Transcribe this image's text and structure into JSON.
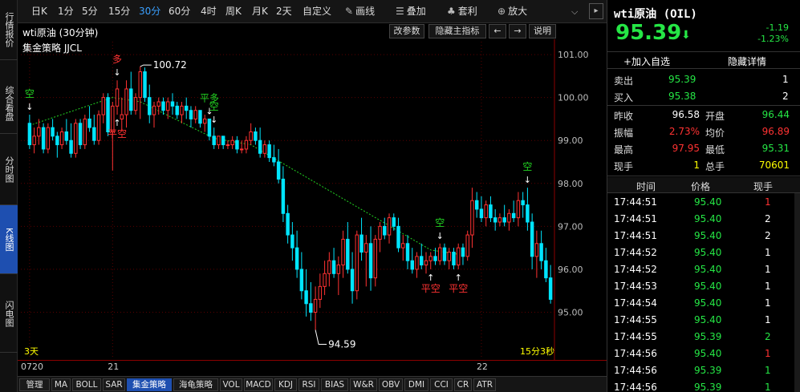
{
  "left_nav": [
    {
      "label": "行情报价",
      "active": false
    },
    {
      "label": "综合看盘",
      "active": false
    },
    {
      "label": "分时图",
      "active": false
    },
    {
      "label": "K线图",
      "active": true
    },
    {
      "label": "闪电图",
      "active": false
    }
  ],
  "toolbar": {
    "periods": [
      "日K",
      "1分",
      "5分",
      "15分",
      "30分",
      "60分",
      "4时",
      "周K",
      "月K",
      "2天",
      "自定义"
    ],
    "active_period": "30分",
    "tools": [
      {
        "label": "画线",
        "icon": "pen-icon"
      },
      {
        "label": "叠加",
        "icon": "layers-icon"
      },
      {
        "label": "套利",
        "icon": "moneybag-icon"
      },
      {
        "label": "放大",
        "icon": "zoom-in-icon"
      }
    ]
  },
  "chart_header": {
    "title": "wti原油 (30分钟)",
    "buttons": [
      "改参数",
      "隐藏主指标",
      "←",
      "→",
      "说明"
    ],
    "strategy": "集金策略 JJCL",
    "bottom_left_label": "3天",
    "bottom_right_label": "15分3秒"
  },
  "chart_data": {
    "type": "candlestick",
    "title": "wti原油 (30分钟)",
    "ylim": [
      94.3,
      101.3
    ],
    "y_ticks": [
      "101.00",
      "100.00",
      "99.00",
      "98.00",
      "97.00",
      "96.00",
      "95.00"
    ],
    "x_labels": [
      "0720",
      "21",
      "22"
    ],
    "candles": [
      [
        99.4,
        99.6,
        98.8,
        98.9
      ],
      [
        98.9,
        99.3,
        98.7,
        99.1
      ],
      [
        99.1,
        99.5,
        98.9,
        99.3
      ],
      [
        99.3,
        99.4,
        98.7,
        98.8
      ],
      [
        98.8,
        99.4,
        98.7,
        99.3
      ],
      [
        99.3,
        99.5,
        99.0,
        99.1
      ],
      [
        99.1,
        99.2,
        98.6,
        98.9
      ],
      [
        98.9,
        99.3,
        98.8,
        99.2
      ],
      [
        99.2,
        99.5,
        98.9,
        99.0
      ],
      [
        99.0,
        99.4,
        98.6,
        98.7
      ],
      [
        98.7,
        99.5,
        98.6,
        99.4
      ],
      [
        99.4,
        99.5,
        98.8,
        98.9
      ],
      [
        98.9,
        99.6,
        98.8,
        99.5
      ],
      [
        99.5,
        99.8,
        99.2,
        99.3
      ],
      [
        99.3,
        99.6,
        98.9,
        99.0
      ],
      [
        99.0,
        99.7,
        98.9,
        99.6
      ],
      [
        99.6,
        100.1,
        99.4,
        100.0
      ],
      [
        100.0,
        100.1,
        99.1,
        99.2
      ],
      [
        99.2,
        99.9,
        98.3,
        99.8
      ],
      [
        99.8,
        100.4,
        99.6,
        100.2
      ],
      [
        99.5,
        100.0,
        99.2,
        99.6
      ],
      [
        99.6,
        100.4,
        99.3,
        100.2
      ],
      [
        100.2,
        100.6,
        99.6,
        99.7
      ],
      [
        99.7,
        100.1,
        99.6,
        100.0
      ],
      [
        100.0,
        100.72,
        99.5,
        100.6
      ],
      [
        100.6,
        100.7,
        99.9,
        100.0
      ],
      [
        100.0,
        100.3,
        99.4,
        99.6
      ],
      [
        99.6,
        99.9,
        99.3,
        99.8
      ],
      [
        99.8,
        100.0,
        99.6,
        99.9
      ],
      [
        99.9,
        100.0,
        99.6,
        99.7
      ],
      [
        99.7,
        100.0,
        99.5,
        99.9
      ],
      [
        99.9,
        100.1,
        99.6,
        99.8
      ],
      [
        99.8,
        99.9,
        99.5,
        99.6
      ],
      [
        99.6,
        99.9,
        99.4,
        99.8
      ],
      [
        99.8,
        100.0,
        99.5,
        99.7
      ],
      [
        99.7,
        99.8,
        99.3,
        99.5
      ],
      [
        99.5,
        99.8,
        99.4,
        99.7
      ],
      [
        99.7,
        99.7,
        99.3,
        99.4
      ],
      [
        99.4,
        99.6,
        99.2,
        99.5
      ],
      [
        99.5,
        99.5,
        99.0,
        99.1
      ],
      [
        99.1,
        99.3,
        98.8,
        98.9
      ],
      [
        98.9,
        99.1,
        98.8,
        99.1
      ],
      [
        99.1,
        99.1,
        98.8,
        98.9
      ],
      [
        98.9,
        99.0,
        98.8,
        98.9
      ],
      [
        98.9,
        99.1,
        98.8,
        99.0
      ],
      [
        99.0,
        99.1,
        98.7,
        98.8
      ],
      [
        98.8,
        99.0,
        98.7,
        98.8
      ],
      [
        98.8,
        99.1,
        98.7,
        99.0
      ],
      [
        99.0,
        99.4,
        98.9,
        99.2
      ],
      [
        99.2,
        99.3,
        98.9,
        99.0
      ],
      [
        99.0,
        99.3,
        98.6,
        98.7
      ],
      [
        98.7,
        99.0,
        98.6,
        98.9
      ],
      [
        98.9,
        99.0,
        98.5,
        98.6
      ],
      [
        98.6,
        98.9,
        98.4,
        98.5
      ],
      [
        98.5,
        98.8,
        98.0,
        98.1
      ],
      [
        98.1,
        98.4,
        97.1,
        97.3
      ],
      [
        97.3,
        97.5,
        96.6,
        96.8
      ],
      [
        96.8,
        97.1,
        96.2,
        96.5
      ],
      [
        96.5,
        96.9,
        95.8,
        96.0
      ],
      [
        96.0,
        96.4,
        95.3,
        95.5
      ],
      [
        95.5,
        96.0,
        94.9,
        95.2
      ],
      [
        95.2,
        95.7,
        94.8,
        95.0
      ],
      [
        95.0,
        95.6,
        94.59,
        95.3
      ],
      [
        95.3,
        95.9,
        95.1,
        95.6
      ],
      [
        95.6,
        96.2,
        95.4,
        95.9
      ],
      [
        95.9,
        96.4,
        95.6,
        96.2
      ],
      [
        96.2,
        96.5,
        95.8,
        95.9
      ],
      [
        95.9,
        96.3,
        95.4,
        96.1
      ],
      [
        96.1,
        96.9,
        95.8,
        96.7
      ],
      [
        96.7,
        97.1,
        95.9,
        96.0
      ],
      [
        96.0,
        96.4,
        95.2,
        95.5
      ],
      [
        95.5,
        96.9,
        95.3,
        96.8
      ],
      [
        96.8,
        97.2,
        96.2,
        96.4
      ],
      [
        96.4,
        96.8,
        95.6,
        96.6
      ],
      [
        96.6,
        97.0,
        95.5,
        95.8
      ],
      [
        95.8,
        96.8,
        95.6,
        96.7
      ],
      [
        96.7,
        97.1,
        96.4,
        97.0
      ],
      [
        97.0,
        97.2,
        96.7,
        96.8
      ],
      [
        96.8,
        97.3,
        96.6,
        97.2
      ],
      [
        97.2,
        97.3,
        96.9,
        97.0
      ],
      [
        97.0,
        97.2,
        96.4,
        96.5
      ],
      [
        96.5,
        96.8,
        96.2,
        96.6
      ],
      [
        96.6,
        96.8,
        96.0,
        96.2
      ],
      [
        96.2,
        96.5,
        95.9,
        96.0
      ],
      [
        96.0,
        96.4,
        95.8,
        96.3
      ],
      [
        96.3,
        96.6,
        96.0,
        96.1
      ],
      [
        96.1,
        96.4,
        95.9,
        96.2
      ],
      [
        96.2,
        96.4,
        96.0,
        96.3
      ],
      [
        96.3,
        96.5,
        96.1,
        96.2
      ],
      [
        96.2,
        96.6,
        96.1,
        96.5
      ],
      [
        96.5,
        96.6,
        96.1,
        96.2
      ],
      [
        96.2,
        96.5,
        96.0,
        96.4
      ],
      [
        96.4,
        96.5,
        96.0,
        96.1
      ],
      [
        96.1,
        96.6,
        96.0,
        96.5
      ],
      [
        96.5,
        96.6,
        96.1,
        96.3
      ],
      [
        96.3,
        96.9,
        96.2,
        96.8
      ],
      [
        96.8,
        97.9,
        96.5,
        97.6
      ],
      [
        97.6,
        97.8,
        97.2,
        97.4
      ],
      [
        97.4,
        97.7,
        97.1,
        97.2
      ],
      [
        97.2,
        97.6,
        97.0,
        97.5
      ],
      [
        97.5,
        97.7,
        97.1,
        97.2
      ],
      [
        97.2,
        97.4,
        96.9,
        97.1
      ],
      [
        97.1,
        97.3,
        97.0,
        97.2
      ],
      [
        97.2,
        97.5,
        97.0,
        97.1
      ],
      [
        97.1,
        97.4,
        96.9,
        97.3
      ],
      [
        97.3,
        97.6,
        97.1,
        97.2
      ],
      [
        97.2,
        97.8,
        97.0,
        97.6
      ],
      [
        97.6,
        97.8,
        97.2,
        97.5
      ],
      [
        97.5,
        97.9,
        96.9,
        97.1
      ],
      [
        97.1,
        97.3,
        96.0,
        96.3
      ],
      [
        96.3,
        96.9,
        95.8,
        96.6
      ],
      [
        96.6,
        96.9,
        96.0,
        96.2
      ],
      [
        96.2,
        96.5,
        95.7,
        95.8
      ],
      [
        95.8,
        96.1,
        95.2,
        95.3
      ]
    ],
    "signals": [
      {
        "label": "空",
        "index": 0,
        "type": "open-short"
      },
      {
        "label": "多",
        "index": 19,
        "type": "open-long"
      },
      {
        "label": "平空",
        "index": 19,
        "type": "close-short"
      },
      {
        "label": "平多",
        "index": 39,
        "type": "close-long"
      },
      {
        "label": "空",
        "index": 40,
        "type": "open-short"
      },
      {
        "label": "平空",
        "index": 87,
        "type": "close-short"
      },
      {
        "label": "空",
        "index": 89,
        "type": "open-short"
      },
      {
        "label": "平空",
        "index": 93,
        "type": "close-short"
      },
      {
        "label": "空",
        "index": 108,
        "type": "open-short"
      }
    ],
    "annotations": [
      {
        "label": "100.72",
        "index": 24,
        "price": 100.72
      },
      {
        "label": "94.59",
        "index": 62,
        "price": 94.59
      }
    ],
    "trend_path": [
      [
        0,
        99.35
      ],
      [
        18,
        100.0
      ],
      [
        24,
        99.9
      ],
      [
        40,
        99.05
      ],
      [
        48,
        98.9
      ],
      [
        87,
        96.45
      ],
      [
        93,
        96.35
      ]
    ],
    "up_color": "#ff3232",
    "down_color": "#00e5ff",
    "trend_color": "#22d322"
  },
  "quote": {
    "name": "wti原油 (OIL)",
    "price": "95.39",
    "change": "-1.19",
    "change_pct": "-1.23%",
    "add_watch": "+加入自选",
    "hide_detail": "隐藏详情",
    "ask_label": "卖出",
    "ask_price": "95.39",
    "ask_vol": "1",
    "bid_label": "买入",
    "bid_price": "95.38",
    "bid_vol": "2",
    "stats": [
      {
        "l1": "昨收",
        "v1": "96.58",
        "c1": "#ffffff",
        "l2": "开盘",
        "v2": "96.44",
        "c2": "#25e645"
      },
      {
        "l1": "振幅",
        "v1": "2.73%",
        "c1": "#ff3232",
        "l2": "均价",
        "v2": "96.89",
        "c2": "#ff3232"
      },
      {
        "l1": "最高",
        "v1": "97.95",
        "c1": "#ff3232",
        "l2": "最低",
        "v2": "95.31",
        "c2": "#25e645"
      },
      {
        "l1": "现手",
        "v1": "1",
        "c1": "#ffff00",
        "l2": "总手",
        "v2": "70601",
        "c2": "#ffff00"
      }
    ],
    "tick_header": [
      "时间",
      "价格",
      "现手"
    ],
    "ticks": [
      {
        "time": "17:44:51",
        "price": "95.40",
        "vol": "1",
        "vc": "#ff3232"
      },
      {
        "time": "17:44:51",
        "price": "95.40",
        "vol": "2",
        "vc": "#ffffff"
      },
      {
        "time": "17:44:51",
        "price": "95.40",
        "vol": "2",
        "vc": "#ffffff"
      },
      {
        "time": "17:44:52",
        "price": "95.40",
        "vol": "1",
        "vc": "#ffffff"
      },
      {
        "time": "17:44:52",
        "price": "95.40",
        "vol": "1",
        "vc": "#ffffff"
      },
      {
        "time": "17:44:53",
        "price": "95.40",
        "vol": "1",
        "vc": "#ffffff"
      },
      {
        "time": "17:44:54",
        "price": "95.40",
        "vol": "1",
        "vc": "#ffffff"
      },
      {
        "time": "17:44:55",
        "price": "95.40",
        "vol": "1",
        "vc": "#ffffff"
      },
      {
        "time": "17:44:55",
        "price": "95.39",
        "vol": "2",
        "vc": "#25e645"
      },
      {
        "time": "17:44:56",
        "price": "95.40",
        "vol": "1",
        "vc": "#ff3232"
      },
      {
        "time": "17:44:56",
        "price": "95.39",
        "vol": "1",
        "vc": "#25e645"
      },
      {
        "time": "17:44:56",
        "price": "95.39",
        "vol": "1",
        "vc": "#25e645"
      }
    ]
  },
  "bottom_tabs": [
    "管理",
    "MA",
    "BOLL",
    "SAR",
    "集金策略",
    "海龟策略",
    "VOL",
    "MACD",
    "KDJ",
    "RSI",
    "BIAS",
    "W&R",
    "OBV",
    "DMI",
    "CCI",
    "CR",
    "ATR"
  ],
  "bottom_active": "集金策略"
}
